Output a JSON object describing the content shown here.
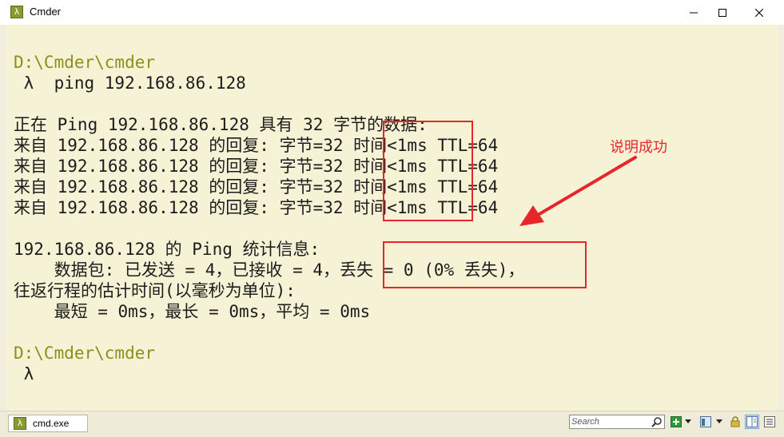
{
  "window": {
    "title": "Cmder",
    "app_icon_glyph": "λ",
    "controls": [
      "minimize-icon",
      "maximize-icon",
      "close-icon"
    ]
  },
  "terminal": {
    "colors": {
      "background": "#f6f2d6",
      "text": "#1c1c1c",
      "path": "#8e8e1c"
    },
    "lines": [
      {
        "text": "D:\\Cmder\\cmder",
        "kind": "path"
      },
      {
        "text": " λ  ping 192.168.86.128",
        "kind": "command"
      },
      {
        "text": "",
        "kind": "blank"
      },
      {
        "text": "正在 Ping 192.168.86.128 具有 32 字节的数据:",
        "kind": "output"
      },
      {
        "text": "来自 192.168.86.128 的回复: 字节=32 时间<1ms TTL=64",
        "kind": "output"
      },
      {
        "text": "来自 192.168.86.128 的回复: 字节=32 时间<1ms TTL=64",
        "kind": "output"
      },
      {
        "text": "来自 192.168.86.128 的回复: 字节=32 时间<1ms TTL=64",
        "kind": "output"
      },
      {
        "text": "来自 192.168.86.128 的回复: 字节=32 时间<1ms TTL=64",
        "kind": "output"
      },
      {
        "text": "",
        "kind": "blank"
      },
      {
        "text": "192.168.86.128 的 Ping 统计信息:",
        "kind": "output"
      },
      {
        "text": "    数据包: 已发送 = 4，已接收 = 4，丢失 = 0 (0% 丢失)，",
        "kind": "output"
      },
      {
        "text": "往返行程的估计时间(以毫秒为单位):",
        "kind": "output"
      },
      {
        "text": "    最短 = 0ms，最长 = 0ms，平均 = 0ms",
        "kind": "output"
      },
      {
        "text": "",
        "kind": "blank"
      },
      {
        "text": "D:\\Cmder\\cmder",
        "kind": "path"
      },
      {
        "text": " λ",
        "kind": "prompt"
      }
    ]
  },
  "annotation": {
    "text": "说明成功",
    "color": "#e8262a"
  },
  "statusbar": {
    "tab_label": "cmd.exe",
    "tab_icon_glyph": "λ",
    "search_placeholder": "Search",
    "buttons": [
      "new-console-icon",
      "dropdown-arrow-icon",
      "view-icon",
      "dropdown-arrow-icon",
      "lock-icon",
      "split-icon",
      "menu-icon"
    ]
  }
}
